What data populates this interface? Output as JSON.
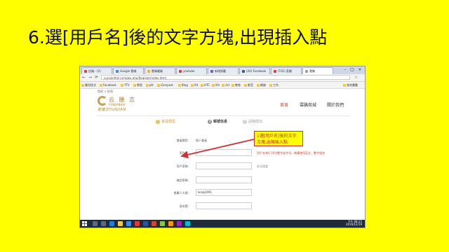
{
  "slide": {
    "title": "6.選[用戶名]後的文字方塊,出現插入點"
  },
  "browser": {
    "tabs": [
      {
        "label": "信箱 - (2)",
        "icon_color": "#d44638"
      },
      {
        "label": "Google 雲端",
        "icon_color": "#4285f4"
      },
      {
        "label": "雲端硬碟",
        "icon_color": "#f4b400"
      },
      {
        "label": "youtube",
        "icon_color": "#e53935"
      },
      {
        "label": "新增頁籤",
        "icon_color": "#7e57c2"
      },
      {
        "label": "(20) Facebook",
        "icon_color": "#3b5998"
      },
      {
        "label": "(T02) 直播",
        "icon_color": "#e53935"
      },
      {
        "label": "雲集",
        "icon_color": "#9e9e9e"
      }
    ],
    "window_controls": [
      "–",
      "□",
      "×"
    ],
    "nav": {
      "back": "←",
      "forward": "→",
      "reload": "⟳"
    },
    "url": "yunjianfhd.cn/index.php/Register/index.html",
    "bookmarks": [
      "應用程式",
      "Facebook",
      "YTV",
      "學習",
      "ptt",
      "iGenpost",
      "Blog",
      "Kit",
      "HTC",
      "life",
      "cld",
      "教育",
      "影音",
      "網路",
      "工作",
      "其他書籤"
    ]
  },
  "page": {
    "breadcrumb": "首頁 > 註冊",
    "logo": {
      "cn": "云 膳 志",
      "en": "YUNJIANHUI",
      "sub": "雲膳志YUNJIAN"
    },
    "nav": [
      {
        "label": "首頁",
        "active": true
      },
      {
        "label": "雲膳商城",
        "active": false
      },
      {
        "label": "關於我們",
        "active": false
      }
    ],
    "steps": [
      {
        "num": "1",
        "label": "會員類型",
        "state": "done"
      },
      {
        "num": "2",
        "label": "帳號信息",
        "state": "current"
      },
      {
        "num": "3",
        "label": "註冊成功",
        "state": "pending"
      }
    ],
    "form": {
      "member_type_label": "會員類型:",
      "member_type_value": "個人會員",
      "username_label": "用戶名:",
      "username_value": "",
      "username_hint": "用戶名為6-16位數字或字母，推薦使用英文、數字組合",
      "password_label": "用戶密碼:",
      "password_value": "",
      "password_hint": "安全程度",
      "confirm_label": "確認密碼:",
      "confirm_value": "",
      "recommender_label": "推薦人卡號:",
      "recommender_value": "kong1491",
      "id_label": "身份證:",
      "id_value": ""
    },
    "callout": "1選[用戶名]後的文字\n方塊,出現插入點"
  },
  "taskbar": {
    "time": "下午 08:15",
    "date": "2016/12/19"
  }
}
